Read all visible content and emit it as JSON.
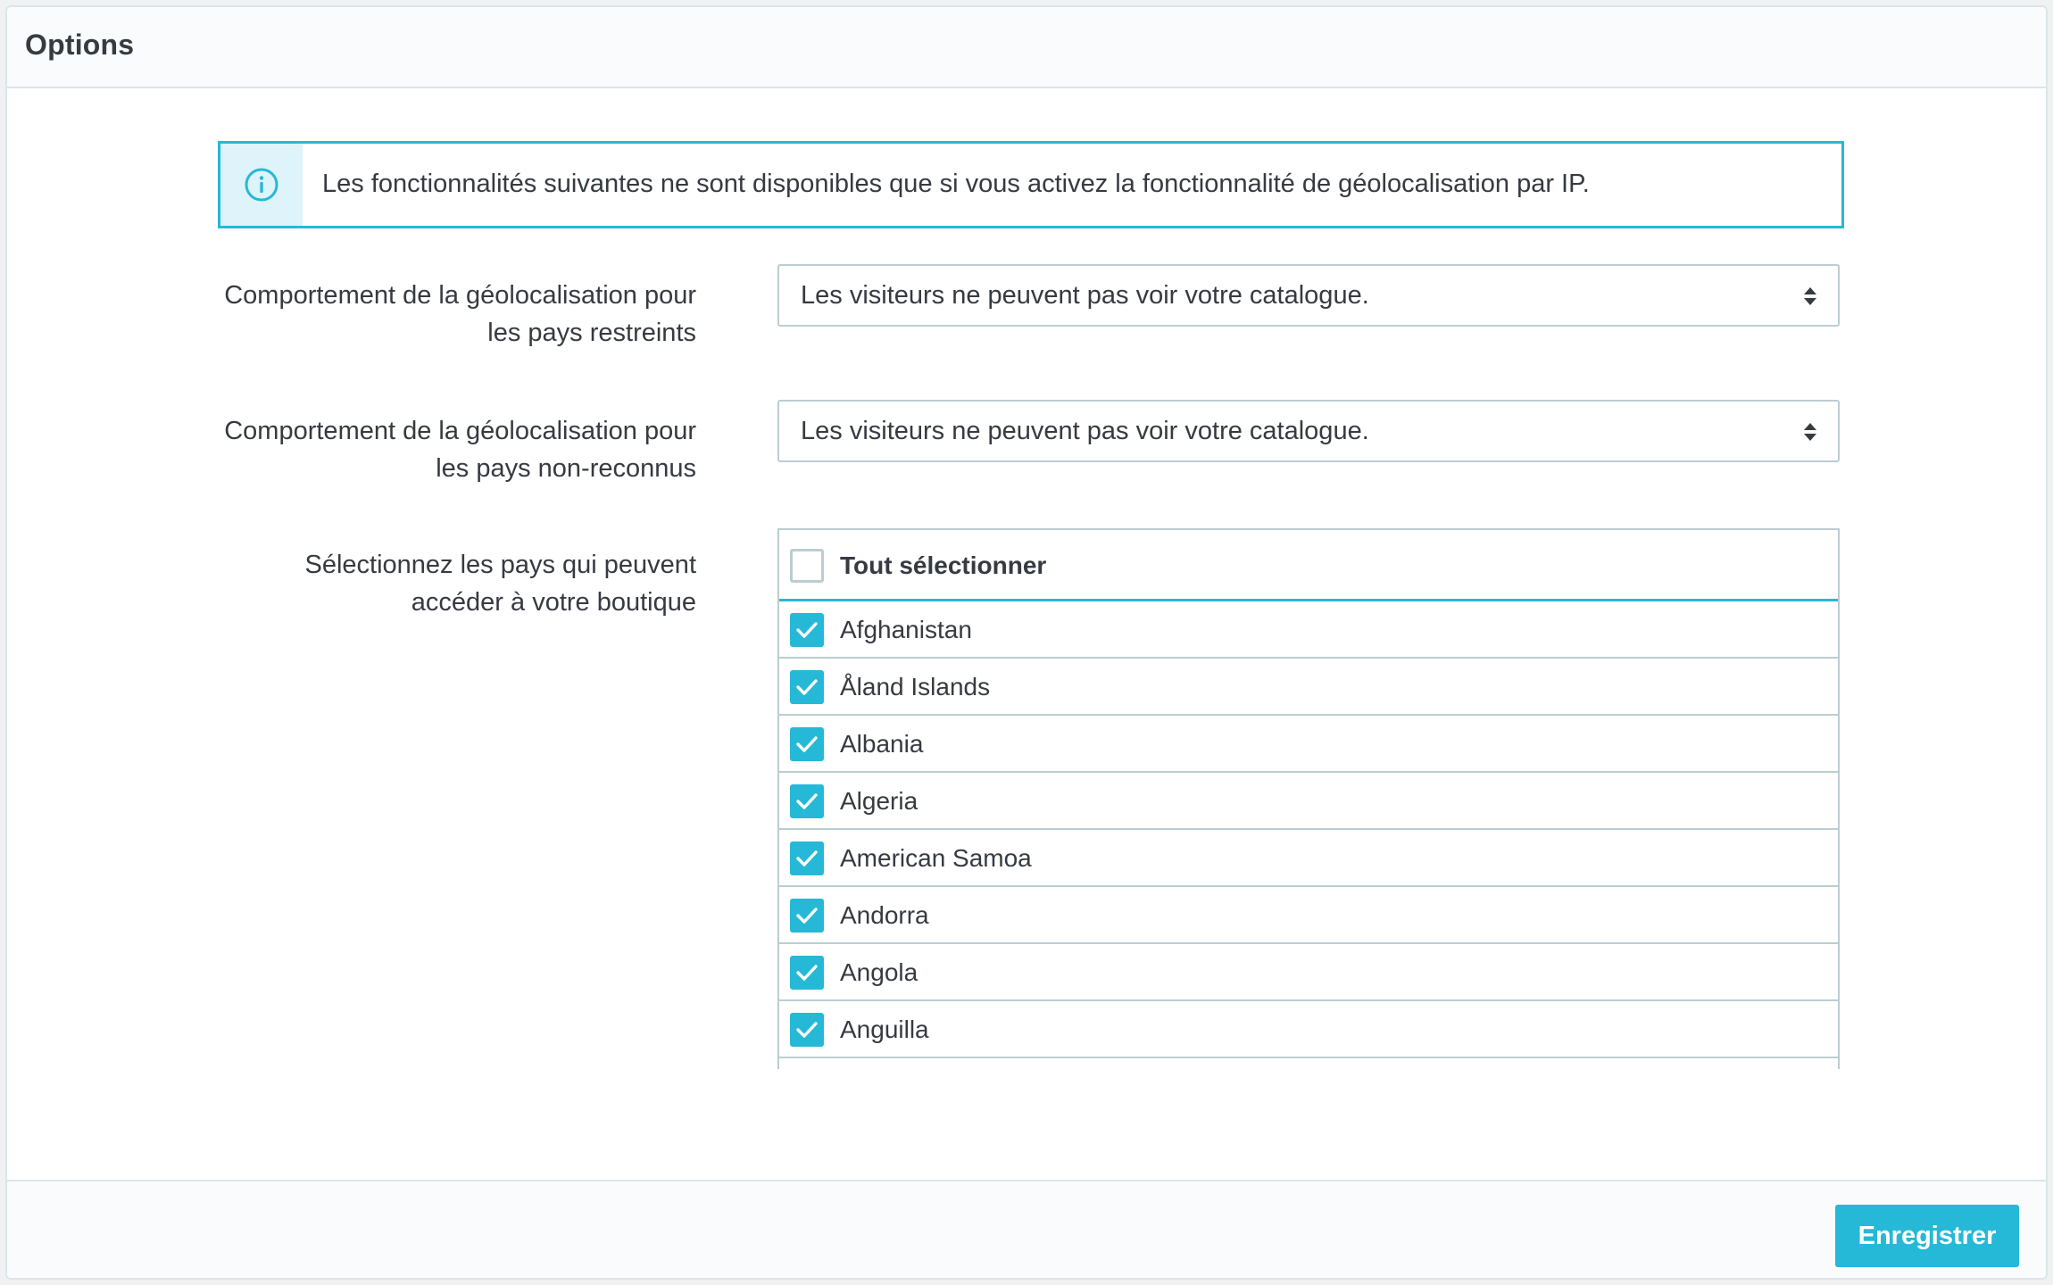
{
  "panel": {
    "title": "Options"
  },
  "alert": {
    "icon": "info-circle-icon",
    "text": "Les fonctionnalités suivantes ne sont disponibles que si vous activez la fonctionnalité de géolocalisation par IP."
  },
  "form": {
    "restricted": {
      "label_line1": "Comportement de la géolocalisation pour",
      "label_line2": "les pays restreints",
      "selected": "Les visiteurs ne peuvent pas voir votre catalogue."
    },
    "unrecognized": {
      "label_line1": "Comportement de la géolocalisation pour",
      "label_line2": "les pays non-reconnus",
      "selected": "Les visiteurs ne peuvent pas voir votre catalogue."
    },
    "countries": {
      "label_line1": "Sélectionnez les pays qui peuvent",
      "label_line2": "accéder à votre boutique",
      "select_all_label": "Tout sélectionner",
      "select_all_checked": false,
      "items": [
        {
          "name": "Afghanistan",
          "checked": true
        },
        {
          "name": "Åland Islands",
          "checked": true
        },
        {
          "name": "Albania",
          "checked": true
        },
        {
          "name": "Algeria",
          "checked": true
        },
        {
          "name": "American Samoa",
          "checked": true
        },
        {
          "name": "Andorra",
          "checked": true
        },
        {
          "name": "Angola",
          "checked": true
        },
        {
          "name": "Anguilla",
          "checked": true
        }
      ]
    }
  },
  "footer": {
    "save_label": "Enregistrer"
  },
  "colors": {
    "accent": "#25b9d7",
    "border": "#bbcdd2",
    "text": "#363a41"
  }
}
